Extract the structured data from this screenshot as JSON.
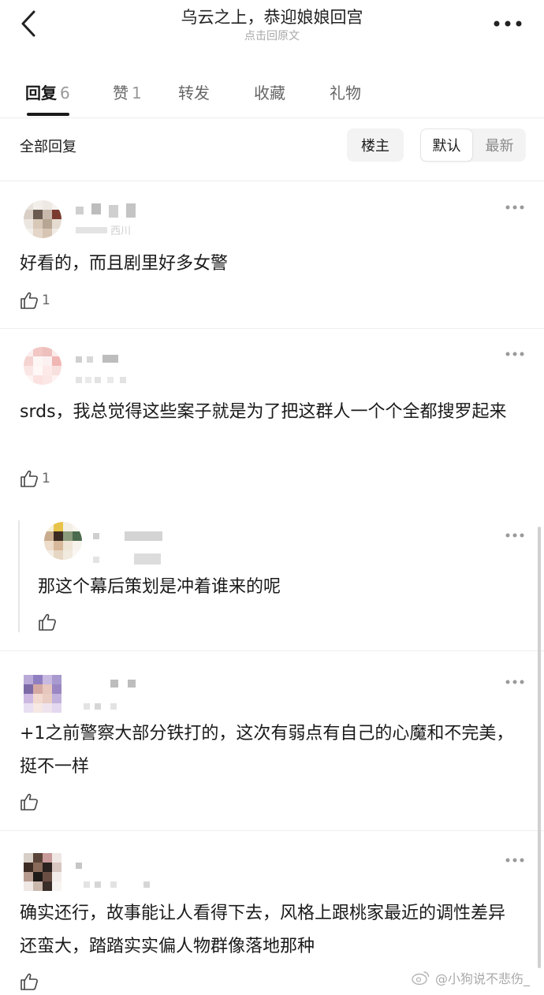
{
  "header": {
    "title": "乌云之上，恭迎娘娘回宫",
    "subtitle": "点击回原文"
  },
  "tabs": [
    {
      "label": "回复",
      "count": "6"
    },
    {
      "label": "赞",
      "count": "1"
    },
    {
      "label": "转发"
    },
    {
      "label": "收藏"
    },
    {
      "label": "礼物"
    }
  ],
  "filter": {
    "label": "全部回复",
    "author_only": "楼主",
    "sort_default": "默认",
    "sort_latest": "最新"
  },
  "comments": [
    {
      "text": "好看的，而且剧里好多女警",
      "likes": "1",
      "meta_partial": "西川"
    },
    {
      "text": "srds，我总觉得这些案子就是为了把这群人一个个全都搜罗起来",
      "likes": "1"
    },
    {
      "text": "那这个幕后策划是冲着谁来的呢",
      "likes": ""
    },
    {
      "text": "+1之前警察大部分铁打的，这次有弱点有自己的心魔和不完美，挺不一样",
      "likes": ""
    },
    {
      "text": "确实还行，故事能让人看得下去，风格上跟桃家最近的调性差异还蛮大，踏踏实实偏人物群像落地那种",
      "likes": ""
    }
  ],
  "watermark": "@小狗说不悲伤_",
  "icons": {
    "back": "chevron-left-icon",
    "more": "more-dots-icon",
    "like": "thumbs-up-icon",
    "watermark": "weibo-icon"
  }
}
